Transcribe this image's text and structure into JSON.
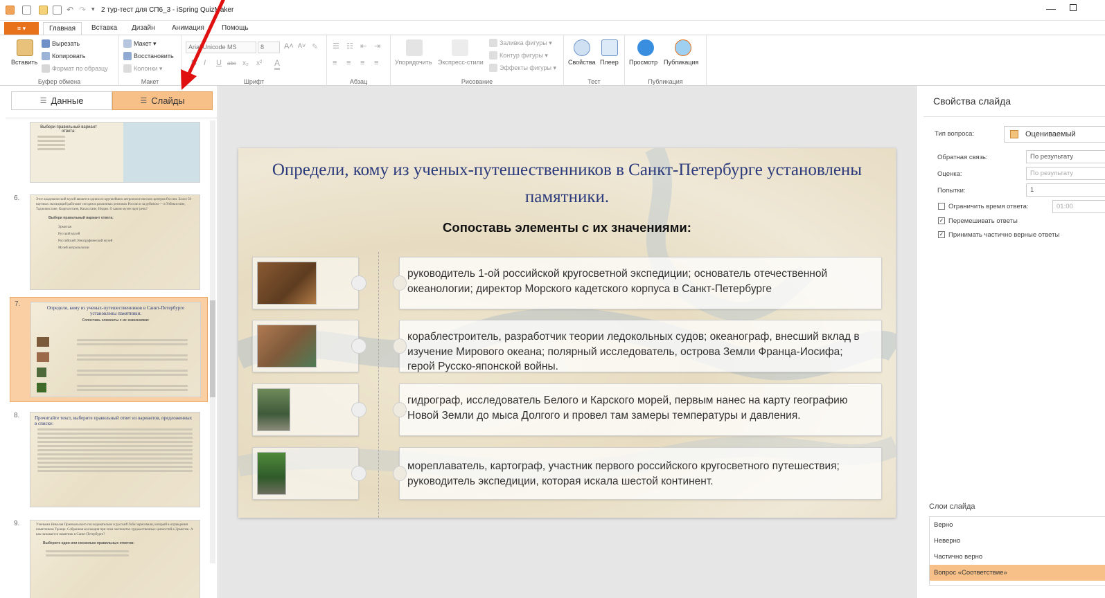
{
  "window": {
    "title": "2 тур-тест для СП6_3 - iSpring QuizMaker"
  },
  "menu": {
    "file": "≡ ▾",
    "tabs": [
      "Главная",
      "Вставка",
      "Дизайн",
      "Анимация",
      "Помощь"
    ]
  },
  "ribbon": {
    "clipboard": {
      "paste": "Вставить",
      "cut": "Вырезать",
      "copy": "Копировать",
      "format_painter": "Формат по образцу",
      "label": "Буфер обмена"
    },
    "layout": {
      "layout": "Макет ▾",
      "reset": "Восстановить",
      "columns": "Колонки ▾",
      "label": "Макет"
    },
    "font": {
      "font_name": "Arial Unicode MS",
      "font_size": "8",
      "label": "Шрифт"
    },
    "paragraph": {
      "label": "Абзац"
    },
    "drawing": {
      "arrange": "Упорядочить",
      "quick_styles": "Экспресс-стили",
      "shape_fill": "Заливка фигуры ▾",
      "shape_outline": "Контур фигуры ▾",
      "shape_effects": "Эффекты фигуры ▾",
      "label": "Рисование"
    },
    "test": {
      "properties": "Свойства",
      "player": "Плеер",
      "label": "Тест"
    },
    "publish": {
      "preview": "Просмотр",
      "publish": "Публикация",
      "label": "Публикация"
    }
  },
  "left_panel": {
    "tab_data": "Данные",
    "tab_slides": "Слайды",
    "slides": [
      {
        "number": "",
        "title": "Выбери правильный вариант ответа:"
      },
      {
        "number": "6.",
        "text": "Этот академический музей является одним из крупнейших антропологических центров России. Более 50 научных экспедиций работают сегодня в различных регионах России и за рубежом — в Узбекистане, Таджикистане, Кыргызстане, Казахстане, Индии. О каком музее идет речь?",
        "prompt": "Выбери правильный вариант ответа:",
        "options": [
          "Эрмитаж",
          "Русский музей",
          "Российский Этнографический музей",
          "Музей антропологии"
        ]
      },
      {
        "number": "7.",
        "title": "Определи, кому из ученых-путешественников в Санкт-Петербурге установлены памятники.",
        "subtitle": "Сопоставь элементы с их значениями:"
      },
      {
        "number": "8.",
        "title": "Прочитайте текст, выберите правильный ответ из вариантов, предложенных в списке:"
      },
      {
        "number": "9.",
        "text": "Учеными Николая Пржевальского последовательно в русский Гоби зарисовали, который в ограждения памятником Троицк. Собранная коллекция при этом экспонатах художественных ценностей в Эрмитаж. А как называется памятник в Санкт-Петербурге?",
        "prompt": "Выберите один или несколько правильных ответов:"
      }
    ]
  },
  "slide": {
    "title": "Определи, кому из ученых-путешественников в Санкт-Петербурге установлены памятники.",
    "subtitle": "Сопоставь элементы с их значениями:",
    "answers": [
      "руководитель 1-ой российской кругосветной экспедиции;  основатель отечественной океанологии; директор Морского кадетского корпуса в Санкт-Петербурге",
      "кораблестроитель, разработчик теории ледокольных судов; океанограф, внесший вклад в изучение Мирового океана;  полярный исследователь, острова Земли Франца-Иосифа; герой Русско-японской войны.",
      "гидрограф, исследователь Белого и Карского морей, первым нанес на карту географию Новой Земли до мыса Долгого и провел там замеры температуры и давления.",
      "мореплаватель, картограф, участник первого российского кругосветного путешествия; руководитель экспедиции, которая искала шестой континент."
    ]
  },
  "right_panel": {
    "title": "Свойства слайда",
    "question_type_label": "Тип вопроса:",
    "question_type": "Оцениваемый",
    "feedback_label": "Обратная связь:",
    "feedback": "По результату",
    "score_label": "Оценка:",
    "score": "По результату",
    "attempts_label": "Попытки:",
    "attempts": "1",
    "limit_time": "Ограничить время ответа:",
    "time_value": "01:00",
    "shuffle": "Перемешивать ответы",
    "partial": "Принимать частично верные ответы",
    "layers_title": "Слои слайда",
    "layers": [
      "Верно",
      "Неверно",
      "Частично верно",
      "Вопрос «Соответствие»"
    ]
  },
  "colors": {
    "accent": "#e8711b",
    "selection": "#f7c089",
    "title_blue": "#2b3a7a",
    "arrow": "#e01010"
  }
}
